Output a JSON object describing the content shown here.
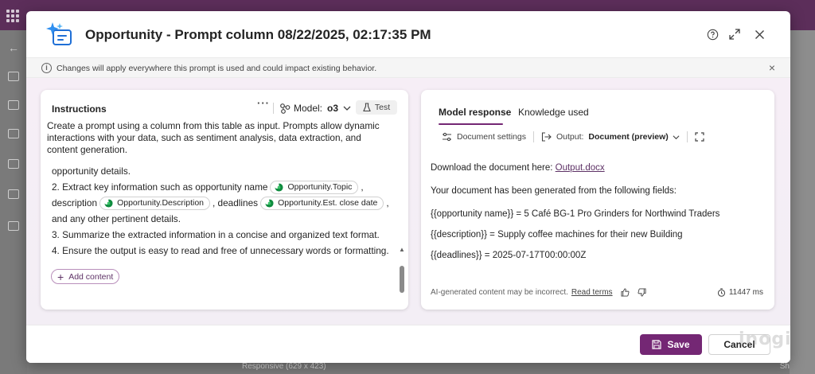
{
  "dialog": {
    "title": "Opportunity - Prompt column 08/22/2025, 02:17:35 PM"
  },
  "notice": {
    "text": "Changes will apply everywhere this prompt is used and could impact existing behavior."
  },
  "instructions": {
    "title": "Instructions",
    "more": "···",
    "model_label": "Model:",
    "model_value": "o3",
    "test_label": "Test",
    "description": "Create a prompt using a column from this table as input. Prompts allow dynamic interactions with your data, such as sentiment analysis, data extraction, and content generation.",
    "line1": "opportunity details.",
    "line2_text": "2. Extract key information such as opportunity name",
    "chip_topic": "Opportunity.Topic",
    "comma": ",",
    "line3_a": "description",
    "chip_description": "Opportunity.Description",
    "line3_b": ", deadlines",
    "chip_close_date": "Opportunity.Est. close date",
    "line4": "and any other pertinent details.",
    "line5": "3. Summarize the extracted information in a concise and organized text format.",
    "line6": "4. Ensure the output is easy to read and free of unnecessary words or formatting.",
    "add_content": "Add content"
  },
  "response": {
    "tabs": [
      "Model response",
      "Knowledge used"
    ],
    "doc_settings": "Document settings",
    "output_label": "Output:",
    "output_value": "Document (preview)",
    "download_text": "Download the document here:",
    "download_link": "Output.docx",
    "generated_text": "Your document has been generated from the following fields:",
    "field1": "{{opportunity name}} = 5 Café BG-1 Pro Grinders for Northwind Traders",
    "field2": "{{description}} = Supply coffee machines for their new Building",
    "field3": "{{deadlines}} = 2025-07-17T00:00:00Z",
    "ai_notice": "AI-generated content may be incorrect.",
    "read_terms": "Read terms",
    "timer": "11447 ms"
  },
  "footer": {
    "save": "Save",
    "cancel": "Cancel"
  },
  "background": {
    "bottom_text": "Responsive (629 x 423)",
    "bottom_right": "Sh"
  },
  "watermark": "inogic",
  "colors": {
    "accent": "#742774",
    "dataverse_chip": "#0f8c3f"
  }
}
